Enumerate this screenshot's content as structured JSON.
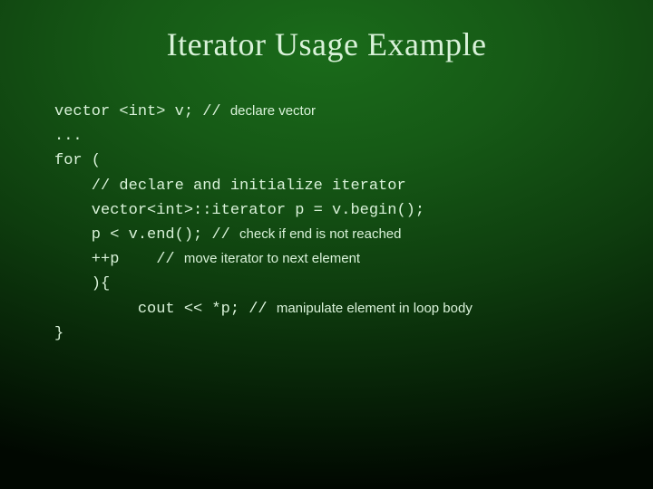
{
  "title": "Iterator Usage Example",
  "lines": {
    "l1_code": "vector <int> v; // ",
    "l1_comment": "declare vector",
    "l2": "...",
    "l3": "for (",
    "l4": "    // declare and initialize iterator",
    "l5": "    vector<int>::iterator p = v.begin();",
    "l6_code": "    p < v.end(); // ",
    "l6_comment": "check if end is not reached",
    "l7_code": "    ++p    // ",
    "l7_comment": "move iterator to next element",
    "l8": "    ){",
    "l9_code": "         cout << *p; // ",
    "l9_comment": "manipulate element in loop body",
    "l10": "}"
  }
}
